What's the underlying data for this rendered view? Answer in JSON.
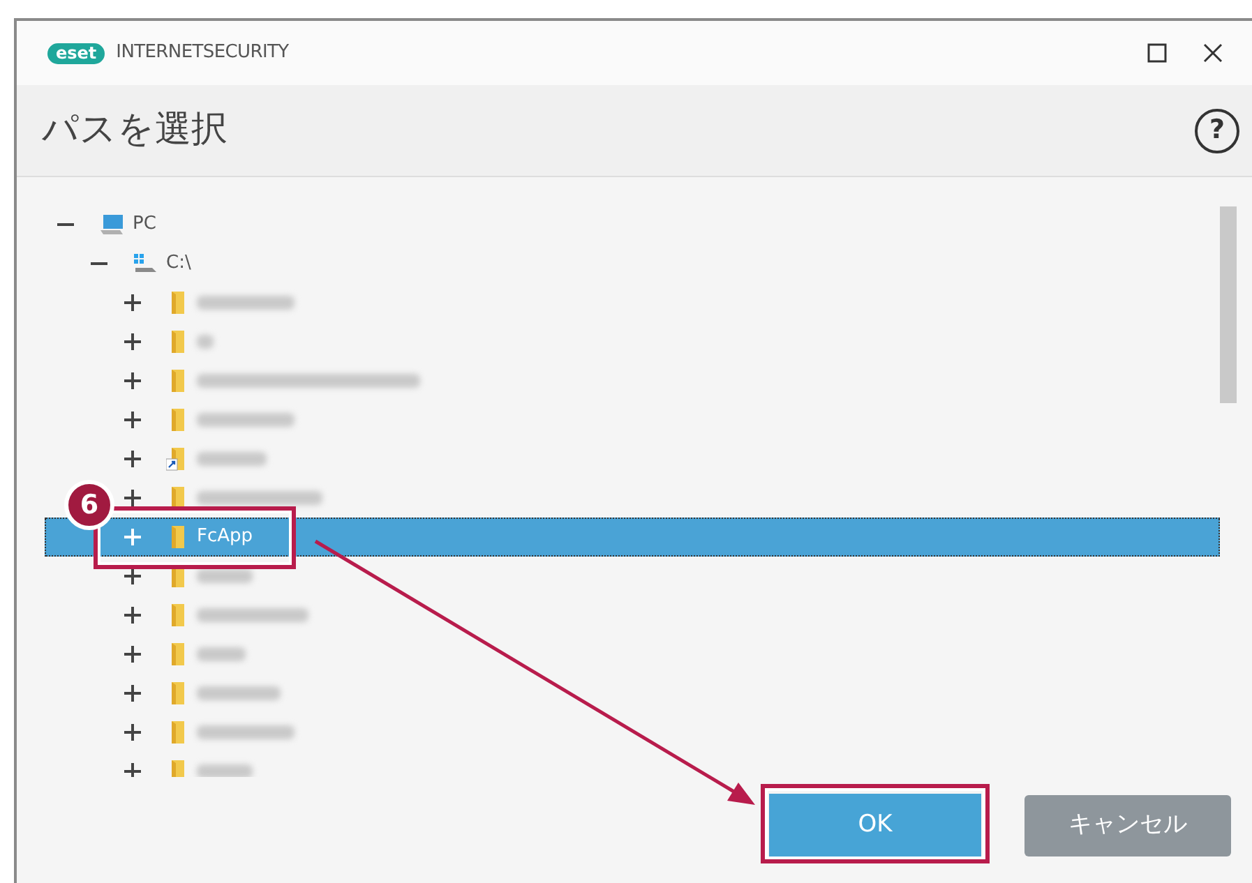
{
  "window": {
    "logo_text": "eset",
    "product": "INTERNETSECURITY"
  },
  "header": {
    "title": "パスを選択",
    "help": "?"
  },
  "tree": [
    {
      "label": "PC",
      "kind": "computer",
      "expanded": true,
      "selected": false,
      "children": [
        {
          "label": "C:\\",
          "kind": "drive",
          "expanded": true,
          "selected": false,
          "children": [
            {
              "kind": "folder",
              "expanded": false,
              "selected": false
            },
            {
              "kind": "folder",
              "expanded": false,
              "selected": false
            },
            {
              "kind": "folder",
              "expanded": false,
              "selected": false
            },
            {
              "kind": "folder",
              "expanded": false,
              "selected": false
            },
            {
              "kind": "shortcut",
              "expanded": false,
              "selected": false
            },
            {
              "kind": "folder",
              "expanded": false,
              "selected": false
            },
            {
              "label": "FcApp",
              "kind": "folder",
              "expanded": false,
              "selected": true
            },
            {
              "kind": "folder",
              "expanded": false,
              "selected": false
            },
            {
              "kind": "folder",
              "expanded": false,
              "selected": false
            },
            {
              "kind": "folder",
              "expanded": false,
              "selected": false
            },
            {
              "kind": "folder",
              "expanded": false,
              "selected": false
            },
            {
              "kind": "folder",
              "expanded": false,
              "selected": false
            },
            {
              "kind": "folder",
              "expanded": false,
              "selected": false
            }
          ]
        }
      ]
    }
  ],
  "buttons": [
    {
      "label": "OK",
      "kind": "primary"
    },
    {
      "label": "キャンセル",
      "kind": "secondary"
    }
  ],
  "annotation": {
    "step": "6"
  }
}
